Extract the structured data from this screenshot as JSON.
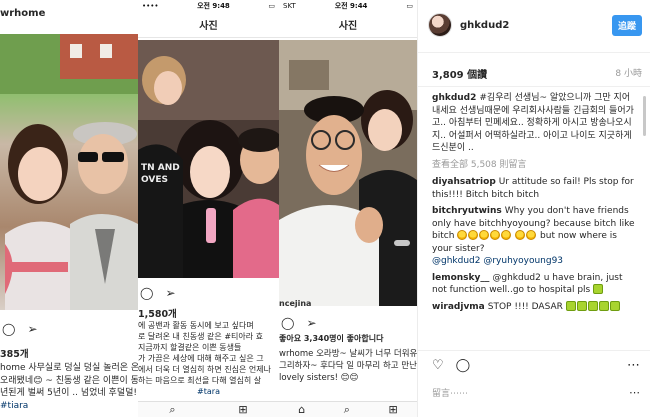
{
  "panel1": {
    "header_username": "wrhome",
    "likes": "385개",
    "caption_lines": [
      "home 사무실로 덩실 덩실 놀러온 온조",
      "오래됐네😊 ~ 친동생 같은 이쁜이 동생",
      "년된게 벌써 5년이 .. 넘었네 후덜덜!! 공 ",
      "#tiara"
    ]
  },
  "panel2": {
    "status_time": "오전 9:48",
    "title": "사진",
    "likes": "1,580개",
    "caption_lines": [
      "에 공밴과 활동 동시에 보고 싶다며",
      "로 달려온 내 친동생 같은 #티아라 효",
      "지금까지 할결같은 이쁜 동생들 ",
      "가 가끔은 세상에 대해 해주고 싶은 그",
      "에서 더욱 더 열심히 하면 진심은 언제나",
      "하는 마음으로 최선을 다해 열심히 살",
      "#tara"
    ]
  },
  "panel3": {
    "status_carrier": "SKT",
    "status_time": "오전 9:44",
    "title": "사진",
    "likes": "좋아요 3,340명이 좋아합니다",
    "caption_lines": [
      "wrhome 오라방~ 날씨가 너무 더워유~ 🐷",
      "그리하자~ 후다닥 일 마무리 하고 만난",
      "lovely sisters! 😊😊"
    ]
  },
  "panel4": {
    "username": "ghkdud2",
    "follow_label": "追蹤",
    "likes": "3,809 個讚",
    "time": "8 小時",
    "view_all": "查看全部 5,508 則留言",
    "comment_placeholder": "留言⋯⋯",
    "caption_user": "ghkdud2",
    "caption_text": "#김우리 선생님~ 알았으니까 그만 지어내세요 선생님때문에 우리회사사람들 긴급회의 들어가고.. 아침부터 민폐세요.. 정확하게 아시고 방송나오시지.. 어설퍼서 어떡하실라고.. 아이고 나이도 지긋하게 드신분이 ..",
    "comments": [
      {
        "user": "diyahsatriop",
        "text": "Ur attitude so fail! Pls stop for this!!!! Bitch bitch bitch"
      },
      {
        "user": "bitchryutwins",
        "text": "Why you don't have friends only have bitchhyoyoung? because bitch like bitch"
      },
      {
        "user": "",
        "text": "but now where is your sister?"
      },
      {
        "user": "lemonsky__",
        "text": "@ghkdud2 u have brain, just not function well..go to hospital pls"
      },
      {
        "user": "wiradjvma",
        "text": "STOP !!!! DASAR"
      }
    ],
    "mentions": "@ghkdud2 @ryuhyoyoung93"
  }
}
